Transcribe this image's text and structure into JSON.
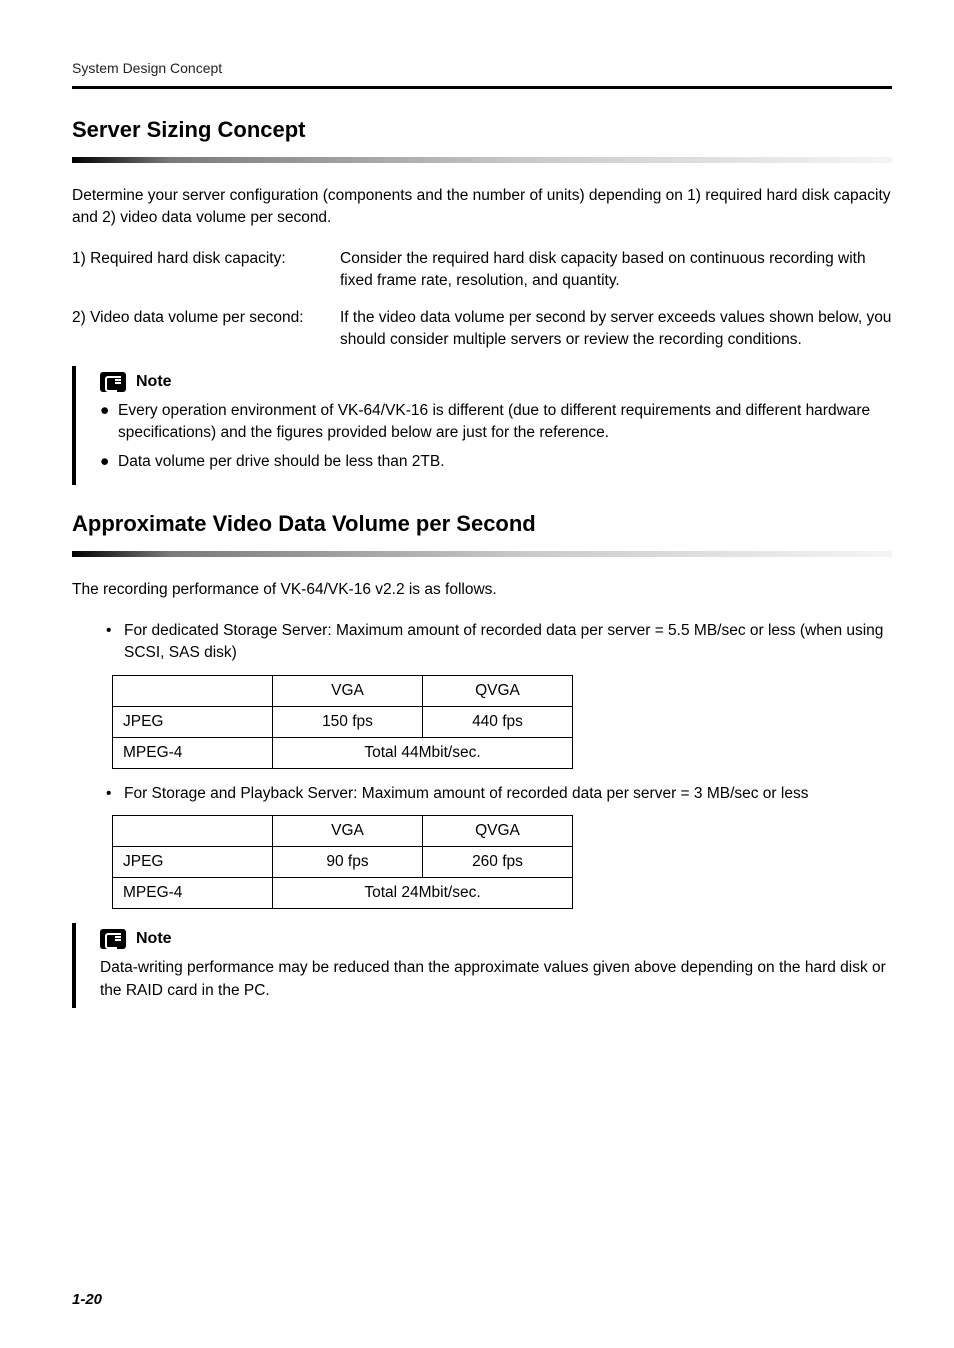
{
  "runningHead": "System Design Concept",
  "section1": {
    "title": "Server Sizing Concept",
    "intro": "Determine your server configuration (components and the number of units) depending on 1) required hard disk capacity and 2) video data volume per second.",
    "defs": [
      {
        "term": "1) Required hard disk capacity:",
        "desc": "Consider the required hard disk capacity based on continuous recording with fixed frame rate, resolution, and quantity."
      },
      {
        "term": "2) Video data volume per second:",
        "desc": "If the video data volume per second by server exceeds values shown below, you should consider multiple servers or review the recording conditions."
      }
    ],
    "noteLabel": "Note",
    "noteItems": [
      "Every operation environment of VK-64/VK-16 is different (due to different requirements and different hardware specifications) and the figures provided below are just for the reference.",
      "Data volume per drive should be less than 2TB."
    ]
  },
  "section2": {
    "title": "Approximate Video Data Volume per Second",
    "intro": "The recording performance of VK-64/VK-16 v2.2 is as follows.",
    "bullets": [
      {
        "text": "For dedicated Storage Server: Maximum amount of recorded data per server = 5.5 MB/sec or less (when using SCSI, SAS disk)"
      },
      {
        "text": "For Storage and Playback Server: Maximum amount of recorded data per server = 3 MB/sec or less"
      }
    ],
    "tables": [
      {
        "headers": [
          "",
          "VGA",
          "QVGA"
        ],
        "rows": [
          {
            "label": "JPEG",
            "vga": "150 fps",
            "qvga": "440 fps"
          },
          {
            "label": "MPEG-4",
            "merged": "Total 44Mbit/sec."
          }
        ]
      },
      {
        "headers": [
          "",
          "VGA",
          "QVGA"
        ],
        "rows": [
          {
            "label": "JPEG",
            "vga": "90 fps",
            "qvga": "260 fps"
          },
          {
            "label": "MPEG-4",
            "merged": "Total 24Mbit/sec."
          }
        ]
      }
    ],
    "noteLabel": "Note",
    "noteText": "Data-writing performance may be reduced than the approximate values given above depending on the hard disk or the RAID card in the PC."
  },
  "pageNumber": "1-20"
}
